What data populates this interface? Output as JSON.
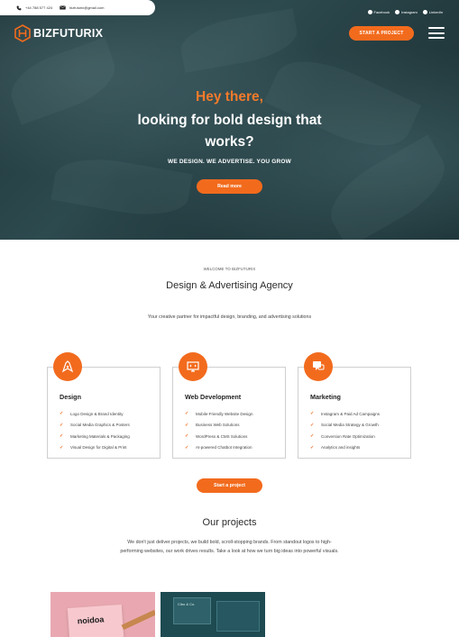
{
  "contact": {
    "phone": "+44 788 577 424",
    "email": "bizfuturix@gmail.com"
  },
  "social": [
    {
      "label": "Facebook",
      "icon": "facebook-icon"
    },
    {
      "label": "Instagram",
      "icon": "instagram-icon"
    },
    {
      "label": "LinkedIn",
      "icon": "linkedin-icon"
    }
  ],
  "brand": {
    "name": "BIZFUTURIX",
    "accent": "#f26b1d"
  },
  "nav": {
    "cta_label": "START A PROJECT",
    "menu_icon": "hamburger-menu-icon"
  },
  "hero": {
    "greeting": "Hey there,",
    "title": "looking for bold design that works?",
    "subtitle": "WE DESIGN. WE ADVERTISE. YOU GROW",
    "button_label": "Read more"
  },
  "about": {
    "eyebrow": "WELCOME TO BIZFUTURIX",
    "title": "Design & Advertising Agency",
    "subtitle": "Your creative partner for impactful design, branding, and advertising solutions"
  },
  "services": [
    {
      "title": "Design",
      "icon": "design-pen-icon",
      "items": [
        "Logo Design & Brand Identity",
        "Social Media Graphics & Posters",
        "Marketing Materials & Packaging",
        "Visual Design for Digital & Print"
      ]
    },
    {
      "title": "Web Development",
      "icon": "monitor-code-icon",
      "items": [
        "Mobile-Friendly Website Design",
        "Business Web Solutions",
        "WordPress & CMS Solutions",
        "AI-powered Chatbot Integration"
      ]
    },
    {
      "title": "Marketing",
      "icon": "megaphone-chat-icon",
      "items": [
        "Instagram & Paid Ad Campaigns",
        "Social Media Strategy & Growth",
        "Conversion Rate Optimization",
        "Analytics and insights"
      ]
    }
  ],
  "services_button_label": "Start a project",
  "projects": {
    "title": "Our projects",
    "description": "We don't just deliver projects, we build bold, scroll-stopping brands. From standout logos to high-performing websites, our work drives results. Take a look at how we turn big ideas into powerful visuals.",
    "thumb1_text": "noidoa",
    "thumb2_text": "Cibo & Co."
  }
}
